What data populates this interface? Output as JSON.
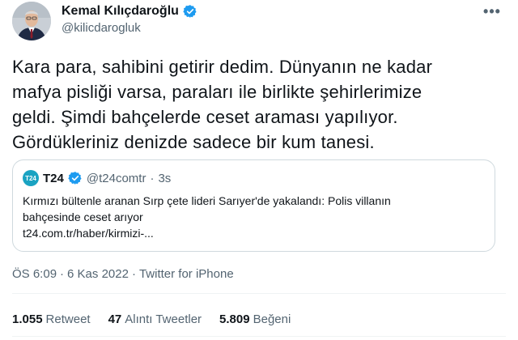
{
  "author": {
    "name": "Kemal Kılıçdaroğlu",
    "handle": "@kilicdarogluk"
  },
  "tweet": {
    "lines": [
      "Kara para, sahibini getirir dedim. Dünyanın ne kadar",
      "mafya pisliği varsa, paraları ile birlikte şehirlerimize",
      "geldi. Şimdi bahçelerde ceset araması yapılıyor.",
      "Gördükleriniz denizde sadece bir kum tanesi."
    ]
  },
  "quote": {
    "logo_text": "T24",
    "name": "T24",
    "handle": "@t24comtr",
    "separator": "·",
    "time": "3s",
    "lines": [
      "Kırmızı bültenle aranan Sırp çete lideri Sarıyer'de yakalandı: Polis villanın",
      "bahçesinde ceset arıyor",
      "t24.com.tr/haber/kirmizi-..."
    ]
  },
  "meta": {
    "time": "ÖS 6:09",
    "separator1": "·",
    "date": "6 Kas 2022",
    "separator2": "·",
    "source": "Twitter for iPhone"
  },
  "stats": [
    {
      "count": "1.055",
      "label": "Retweet"
    },
    {
      "count": "47",
      "label": "Alıntı Tweetler"
    },
    {
      "count": "5.809",
      "label": "Beğeni"
    }
  ],
  "more_symbol": "•••",
  "colors": {
    "verified": "#1d9bf0",
    "secondary_text": "#536471",
    "border": "#cfd9de",
    "t24_logo": "#1aa3c2"
  },
  "icons": {
    "verified": "verified-badge-icon",
    "more": "more-horizontal-icon"
  }
}
